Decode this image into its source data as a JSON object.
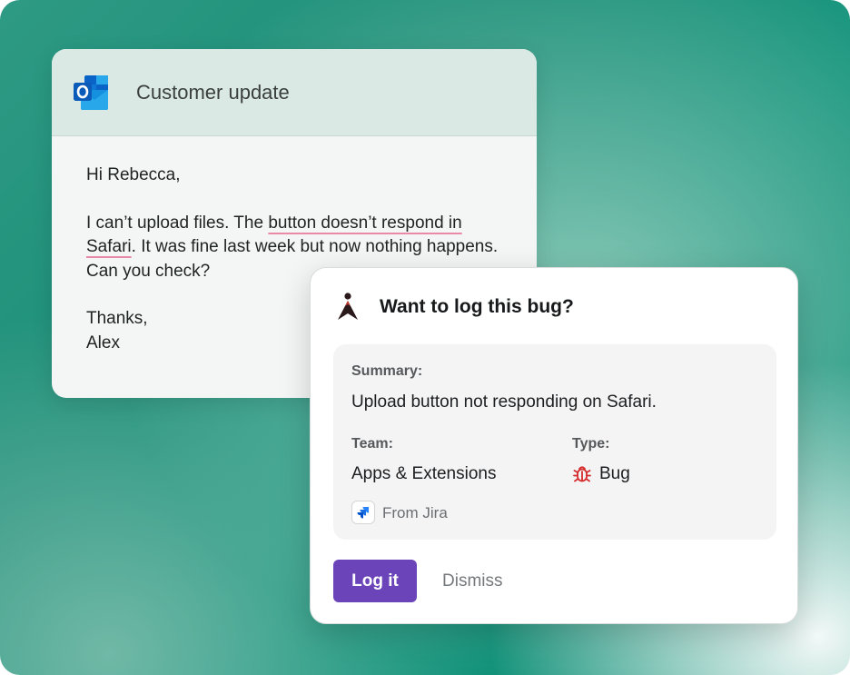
{
  "email": {
    "app_icon": "outlook-icon",
    "title": "Customer update",
    "greeting": "Hi Rebecca,",
    "body": {
      "part1": "I can’t upload files. The ",
      "highlight1": "button doesn’t respond in",
      "highlight2": "Safari",
      "part2": ". It was fine last week but now nothing happens. Can you check?"
    },
    "signoff": "Thanks,",
    "signature": "Alex",
    "highlight_color": "#e88aa8"
  },
  "bug_prompt": {
    "logo_icon": "app-logo-icon",
    "title": "Want to log this bug?",
    "summary_label": "Summary:",
    "summary_value": "Upload button not responding on Safari.",
    "team_label": "Team:",
    "team_value": "Apps & Extensions",
    "type_label": "Type:",
    "type_icon": "bug-icon",
    "type_value": "Bug",
    "source_icon": "jira-icon",
    "source_text": "From Jira",
    "primary_button": "Log it",
    "secondary_button": "Dismiss",
    "accent_color": "#6a44b8",
    "bug_color": "#d52b2b"
  }
}
